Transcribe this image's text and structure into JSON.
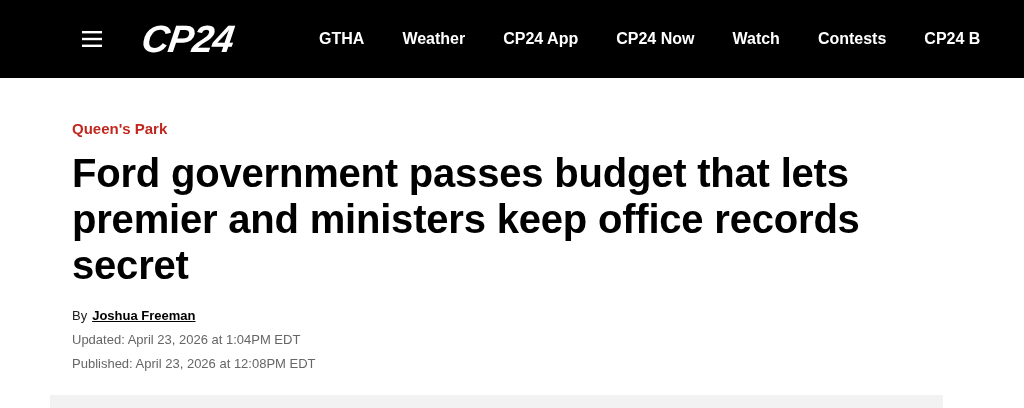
{
  "header": {
    "logo": "CP24",
    "nav": [
      "GTHA",
      "Weather",
      "CP24 App",
      "CP24 Now",
      "Watch",
      "Contests",
      "CP24 B"
    ]
  },
  "article": {
    "category": "Queen's Park",
    "headline": "Ford government passes budget that lets premier and ministers keep office records secret",
    "byline_prefix": "By",
    "author": "Joshua Freeman",
    "updated": "Updated: April 23, 2026 at 1:04PM EDT",
    "published": "Published: April 23, 2026 at 12:08PM EDT"
  }
}
